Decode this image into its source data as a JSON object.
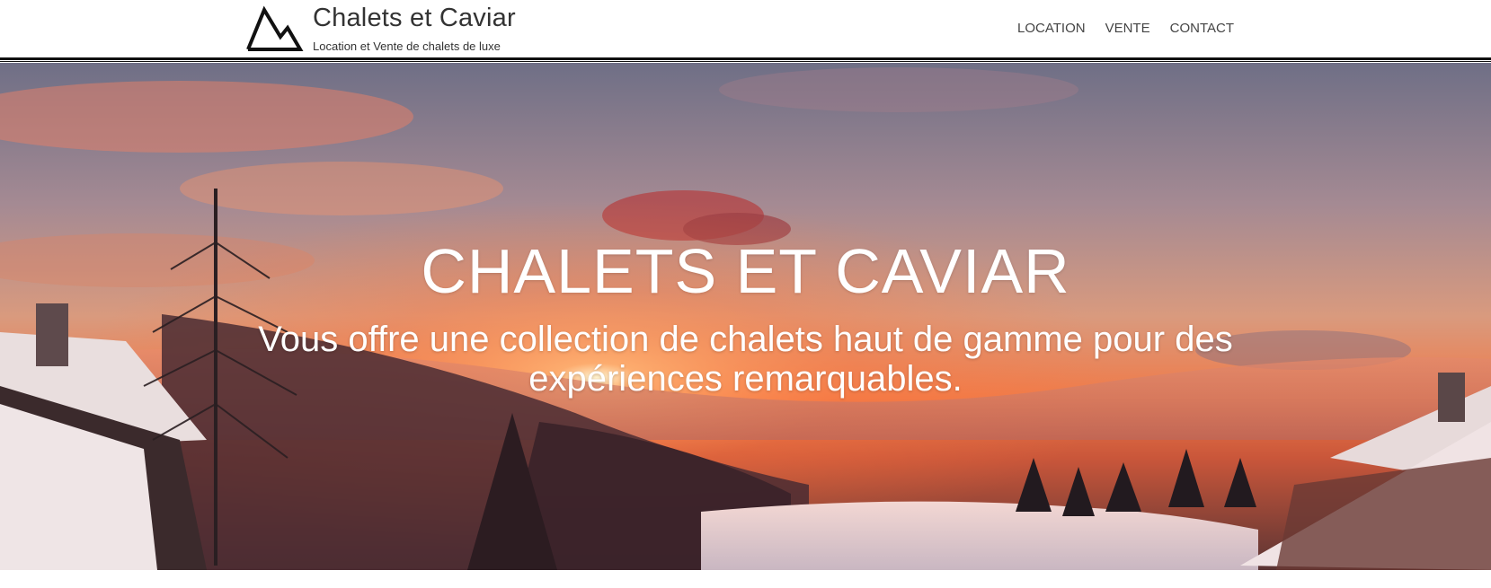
{
  "header": {
    "logo_icon": "mountain-icon",
    "brand_title": "Chalets et Caviar",
    "brand_subtitle": "Location et Vente de chalets de luxe",
    "nav": [
      {
        "label": "LOCATION"
      },
      {
        "label": "VENTE"
      },
      {
        "label": "CONTACT"
      }
    ]
  },
  "hero": {
    "title": "CHALETS ET CAVIAR",
    "text": "Vous offre une collection de chalets haut de gamme pour des expériences remarquables.",
    "image": "sunset-mountain-chalets-photo"
  },
  "colors": {
    "text": "#333333",
    "rule": "#111111",
    "hero_text": "#ffffff"
  }
}
